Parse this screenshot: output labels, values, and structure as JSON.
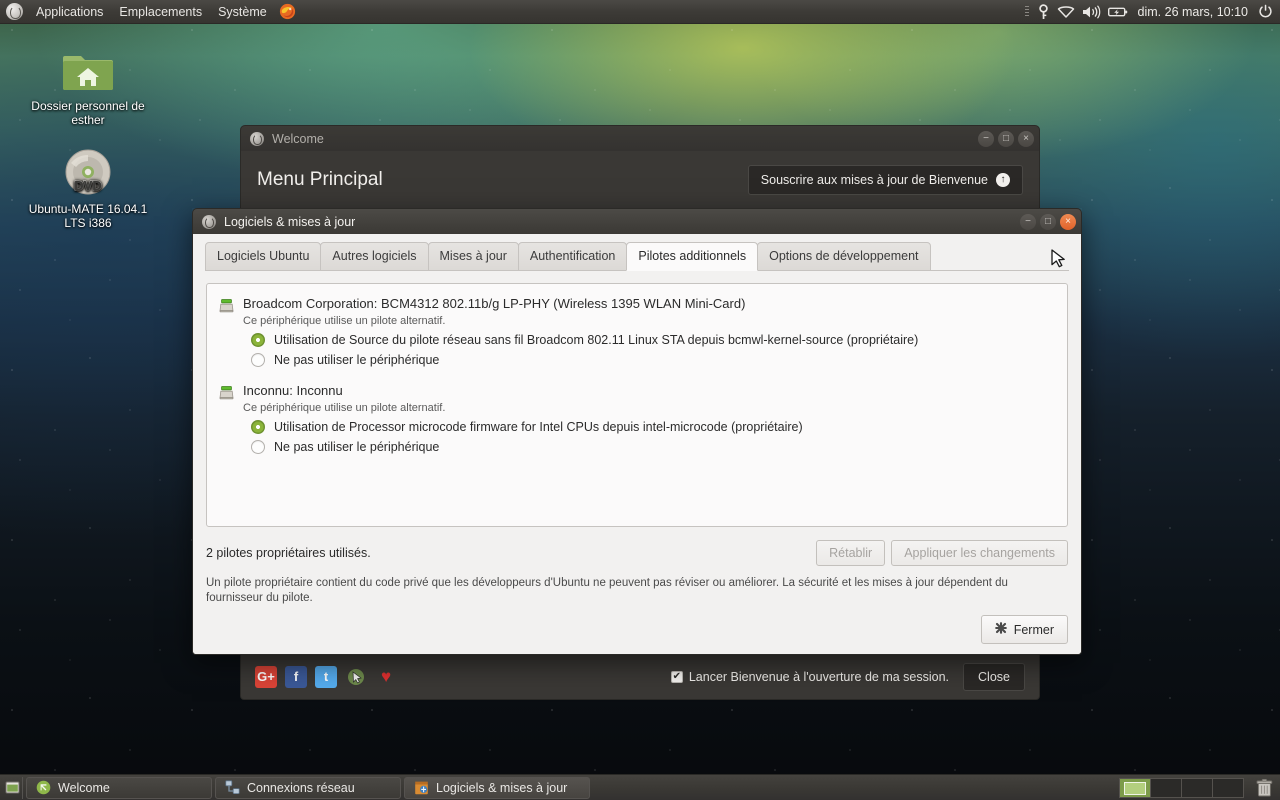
{
  "panel": {
    "logo": "mate-logo",
    "menus": [
      "Applications",
      "Emplacements",
      "Système"
    ],
    "firefox_icon": "firefox-icon",
    "tray": {
      "key_icon": "key-icon",
      "network_icon": "network-wifi-icon",
      "volume_icon": "volume-icon",
      "battery_icon": "battery-icon",
      "power_icon": "power-icon"
    },
    "clock": "dim. 26 mars, 10:10"
  },
  "desktop": {
    "icons": [
      {
        "name": "home-folder",
        "glyph": "home-folder-icon",
        "label": "Dossier personnel de esther"
      },
      {
        "name": "dvd-media",
        "glyph": "dvd-icon",
        "label": "Ubuntu-MATE 16.04.1 LTS i386"
      }
    ]
  },
  "welcome_window": {
    "title": "Welcome",
    "heading": "Menu Principal",
    "subscribe_button": "Souscrire aux mises à jour de Bienvenue",
    "socials": [
      {
        "name": "google-plus-icon",
        "glyph": "G+",
        "color": "#db4437"
      },
      {
        "name": "facebook-icon",
        "glyph": "f",
        "color": "#3b5998"
      },
      {
        "name": "twitter-icon",
        "glyph": "t",
        "color": "#55acee"
      },
      {
        "name": "mate-pointer-icon",
        "glyph": "",
        "color": "#6e8a4c"
      },
      {
        "name": "heart-icon",
        "glyph": "♥",
        "color": "#e03030"
      }
    ],
    "autostart_label": "Lancer Bienvenue à l'ouverture de ma session.",
    "autostart_checked": true,
    "close_button": "Close",
    "window_buttons": {
      "minimize": "−",
      "maximize": "□",
      "close": "×"
    }
  },
  "software_window": {
    "title": "Logiciels & mises à jour",
    "window_buttons": {
      "minimize": "−",
      "maximize": "□",
      "close": "×"
    },
    "tabs": [
      {
        "label": "Logiciels Ubuntu",
        "active": false
      },
      {
        "label": "Autres logiciels",
        "active": false
      },
      {
        "label": "Mises à jour",
        "active": false
      },
      {
        "label": "Authentification",
        "active": false
      },
      {
        "label": "Pilotes additionnels",
        "active": true
      },
      {
        "label": "Options de développement",
        "active": false
      }
    ],
    "driver_groups": [
      {
        "device": "Broadcom Corporation: BCM4312 802.11b/g LP-PHY (Wireless 1395 WLAN Mini-Card)",
        "subtitle": "Ce périphérique utilise un pilote alternatif.",
        "options": [
          {
            "label": "Utilisation de Source du pilote réseau sans fil Broadcom 802.11 Linux STA depuis bcmwl-kernel-source (propriétaire)",
            "selected": true
          },
          {
            "label": "Ne pas utiliser le périphérique",
            "selected": false
          }
        ]
      },
      {
        "device": "Inconnu: Inconnu",
        "subtitle": "Ce périphérique utilise un pilote alternatif.",
        "options": [
          {
            "label": "Utilisation de Processor microcode firmware for Intel CPUs depuis intel-microcode (propriétaire)",
            "selected": true
          },
          {
            "label": "Ne pas utiliser le périphérique",
            "selected": false
          }
        ]
      }
    ],
    "status_text": "2 pilotes propriétaires utilisés.",
    "revert_button": "Rétablir",
    "apply_button": "Appliquer les changements",
    "legal_text": "Un pilote propriétaire contient du code privé que les développeurs d'Ubuntu ne peuvent pas réviser ou améliorer. La sécurité et les mises à jour dépendent du fournisseur du pilote.",
    "close_button": "Fermer",
    "close_button_icon": "close-x-icon"
  },
  "taskbar": {
    "show_desktop_icon": "show-desktop-icon",
    "tasks": [
      {
        "label": "Welcome",
        "icon": "welcome-icon",
        "active": false
      },
      {
        "label": "Connexions réseau",
        "icon": "network-connections-icon",
        "active": false
      },
      {
        "label": "Logiciels & mises à jour",
        "icon": "software-updates-icon",
        "active": true
      }
    ],
    "workspaces": [
      {
        "active": true
      },
      {
        "active": false
      },
      {
        "active": false
      },
      {
        "active": false
      }
    ],
    "trash_icon": "trash-icon"
  },
  "colors": {
    "panel_bg": "#3d3b37",
    "accent_green": "#8bb43a",
    "close_red": "#e0622a",
    "dialog_bg": "#f2f1f0"
  }
}
